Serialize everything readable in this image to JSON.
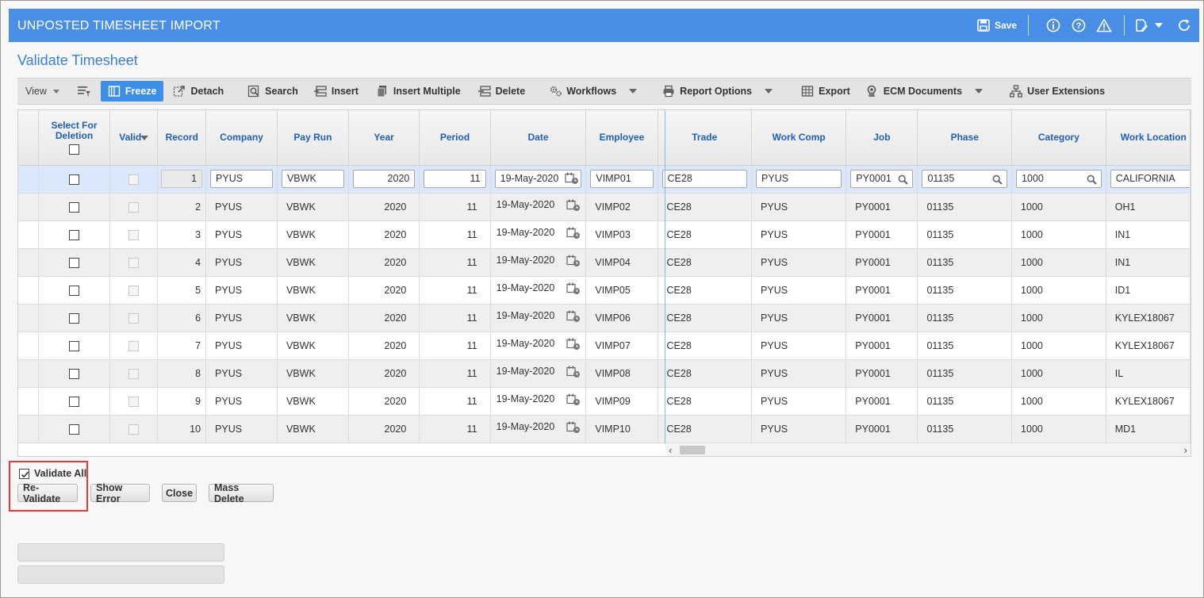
{
  "window": {
    "title": "UNPOSTED TIMESHEET IMPORT",
    "save_label": "Save"
  },
  "subtitle": "Validate Timesheet",
  "toolbar": {
    "view": "View",
    "freeze": "Freeze",
    "detach": "Detach",
    "search": "Search",
    "insert": "Insert",
    "insert_multiple": "Insert Multiple",
    "delete": "Delete",
    "workflows": "Workflows",
    "report_options": "Report Options",
    "export": "Export",
    "ecm_documents": "ECM Documents",
    "user_extensions": "User Extensions"
  },
  "columns": {
    "select_line1": "Select For",
    "select_line2": "Deletion",
    "valid": "Valid",
    "record": "Record",
    "company": "Company",
    "pay_run": "Pay Run",
    "year": "Year",
    "period": "Period",
    "date": "Date",
    "employee": "Employee",
    "trade": "Trade",
    "work_comp": "Work Comp",
    "job": "Job",
    "phase": "Phase",
    "category": "Category",
    "work_location": "Work Location"
  },
  "rows": [
    {
      "record": "1",
      "company": "PYUS",
      "pay_run": "VBWK",
      "year": "2020",
      "period": "11",
      "date": "19-May-2020",
      "employee": "VIMP01",
      "trade": "CE28",
      "work_comp": "PYUS",
      "job": "PY0001",
      "phase": "01135",
      "category": "1000",
      "work_location": "CALIFORNIA"
    },
    {
      "record": "2",
      "company": "PYUS",
      "pay_run": "VBWK",
      "year": "2020",
      "period": "11",
      "date": "19-May-2020",
      "employee": "VIMP02",
      "trade": "CE28",
      "work_comp": "PYUS",
      "job": "PY0001",
      "phase": "01135",
      "category": "1000",
      "work_location": "OH1"
    },
    {
      "record": "3",
      "company": "PYUS",
      "pay_run": "VBWK",
      "year": "2020",
      "period": "11",
      "date": "19-May-2020",
      "employee": "VIMP03",
      "trade": "CE28",
      "work_comp": "PYUS",
      "job": "PY0001",
      "phase": "01135",
      "category": "1000",
      "work_location": "IN1"
    },
    {
      "record": "4",
      "company": "PYUS",
      "pay_run": "VBWK",
      "year": "2020",
      "period": "11",
      "date": "19-May-2020",
      "employee": "VIMP04",
      "trade": "CE28",
      "work_comp": "PYUS",
      "job": "PY0001",
      "phase": "01135",
      "category": "1000",
      "work_location": "IN1"
    },
    {
      "record": "5",
      "company": "PYUS",
      "pay_run": "VBWK",
      "year": "2020",
      "period": "11",
      "date": "19-May-2020",
      "employee": "VIMP05",
      "trade": "CE28",
      "work_comp": "PYUS",
      "job": "PY0001",
      "phase": "01135",
      "category": "1000",
      "work_location": "ID1"
    },
    {
      "record": "6",
      "company": "PYUS",
      "pay_run": "VBWK",
      "year": "2020",
      "period": "11",
      "date": "19-May-2020",
      "employee": "VIMP06",
      "trade": "CE28",
      "work_comp": "PYUS",
      "job": "PY0001",
      "phase": "01135",
      "category": "1000",
      "work_location": "KYLEX18067"
    },
    {
      "record": "7",
      "company": "PYUS",
      "pay_run": "VBWK",
      "year": "2020",
      "period": "11",
      "date": "19-May-2020",
      "employee": "VIMP07",
      "trade": "CE28",
      "work_comp": "PYUS",
      "job": "PY0001",
      "phase": "01135",
      "category": "1000",
      "work_location": "KYLEX18067"
    },
    {
      "record": "8",
      "company": "PYUS",
      "pay_run": "VBWK",
      "year": "2020",
      "period": "11",
      "date": "19-May-2020",
      "employee": "VIMP08",
      "trade": "CE28",
      "work_comp": "PYUS",
      "job": "PY0001",
      "phase": "01135",
      "category": "1000",
      "work_location": "IL"
    },
    {
      "record": "9",
      "company": "PYUS",
      "pay_run": "VBWK",
      "year": "2020",
      "period": "11",
      "date": "19-May-2020",
      "employee": "VIMP09",
      "trade": "CE28",
      "work_comp": "PYUS",
      "job": "PY0001",
      "phase": "01135",
      "category": "1000",
      "work_location": "KYLEX18067"
    },
    {
      "record": "10",
      "company": "PYUS",
      "pay_run": "VBWK",
      "year": "2020",
      "period": "11",
      "date": "19-May-2020",
      "employee": "VIMP10",
      "trade": "CE28",
      "work_comp": "PYUS",
      "job": "PY0001",
      "phase": "01135",
      "category": "1000",
      "work_location": "MD1"
    }
  ],
  "footer": {
    "validate_all": "Validate All",
    "validate_all_checked": true,
    "revalidate": "Re-Validate",
    "show_error": "Show Error",
    "close": "Close",
    "mass_delete": "Mass Delete"
  },
  "colors": {
    "titlebar": "#4a8fe7",
    "accent": "#3d8ee6",
    "header_text": "#1f5fb8",
    "highlight": "#e13b3b"
  }
}
